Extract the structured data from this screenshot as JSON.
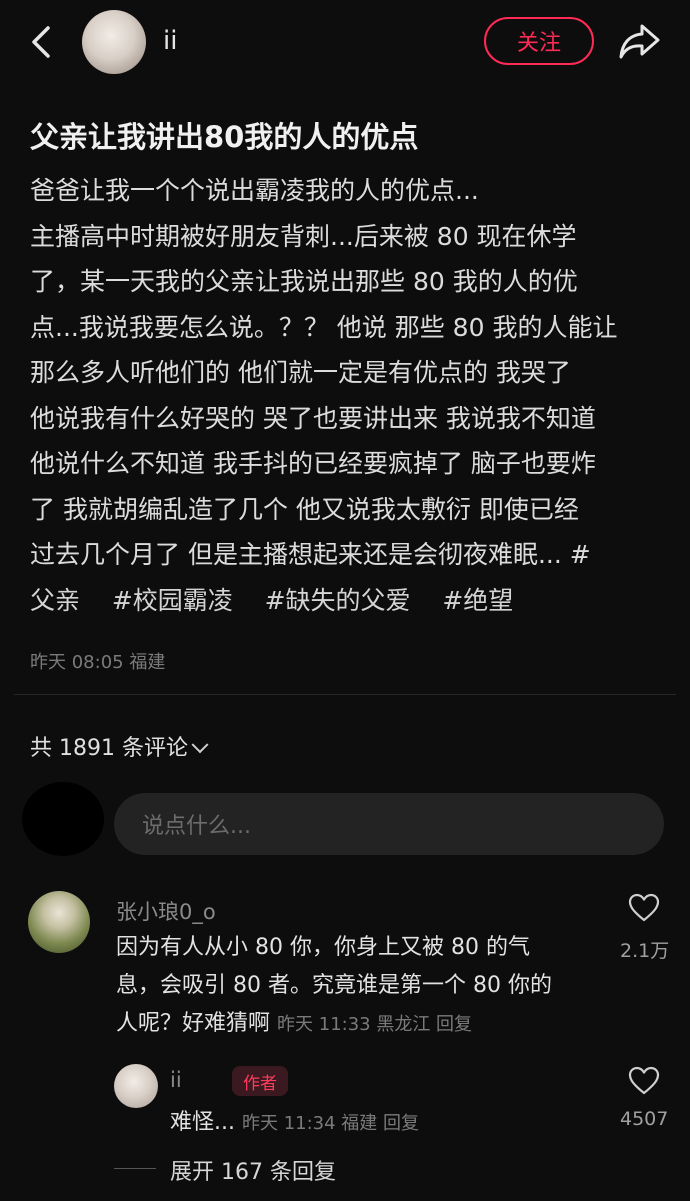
{
  "header": {
    "username": "ii",
    "follow_label": "关注"
  },
  "post": {
    "title": "父亲让我讲出80我的人的优点",
    "lines": [
      "爸爸让我一个个说出霸凌我的人的优点...",
      "主播高中时期被好朋友背刺...后来被 80 现在休学",
      "了，某一天我的父亲让我说出那些 80 我的人的优",
      "点...我说我要怎么说。？？ 他说 那些 80 我的人能让",
      "那么多人听他们的 他们就一定是有优点的 我哭了",
      "他说我有什么好哭的 哭了也要讲出来 我说我不知道",
      "他说什么不知道 我手抖的已经要疯掉了 脑子也要炸",
      "了 我就胡编乱造了几个 他又说我太敷衍 即使已经",
      "过去几个月了 但是主播想起来还是会彻夜难眠... #"
    ],
    "tags": [
      "父亲",
      "#校园霸凌",
      "#缺失的父爱",
      "#绝望"
    ],
    "meta": "昨天 08:05 福建"
  },
  "comments_header": {
    "count_label": "共 1891 条评论"
  },
  "composer": {
    "placeholder": "说点什么..."
  },
  "comment": {
    "author": "张小琅0_o",
    "lines": [
      "因为有人从小 80 你，你身上又被 80 的气",
      "息，会吸引 80 者。究竟谁是第一个 80 你的"
    ],
    "last_line": "人呢？好难猜啊",
    "meta": "昨天 11:33 黑龙江 回复",
    "like_count": "2.1万"
  },
  "reply": {
    "author": "ii",
    "badge": "作者",
    "text": "难怪...",
    "meta": "昨天 11:34 福建 回复",
    "like_count": "4507"
  },
  "expand_label": "展开 167 条回复",
  "icons": {
    "back": "chevron-left-icon",
    "share": "share-arrow-icon",
    "like": "heart-outline-icon",
    "dropdown": "chevron-down-icon"
  }
}
